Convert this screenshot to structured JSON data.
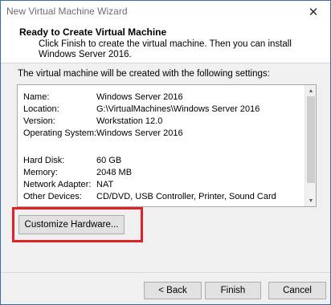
{
  "window": {
    "title": "New Virtual Machine Wizard",
    "close_glyph": "✕"
  },
  "header": {
    "title": "Ready to Create Virtual Machine",
    "subtitle": "Click Finish to create the virtual machine. Then you can install Windows Server 2016."
  },
  "intro": "The virtual machine will be created with the following settings:",
  "settings": [
    {
      "label": "Name:",
      "value": "Windows Server 2016"
    },
    {
      "label": "Location:",
      "value": "G:\\VirtualMachines\\Windows Server 2016"
    },
    {
      "label": "Version:",
      "value": "Workstation 12.0"
    },
    {
      "label": "Operating System:",
      "value": "Windows Server 2016"
    },
    {
      "label": "Hard Disk:",
      "value": "60 GB"
    },
    {
      "label": "Memory:",
      "value": "2048 MB"
    },
    {
      "label": "Network Adapter:",
      "value": "NAT"
    },
    {
      "label": "Other Devices:",
      "value": "CD/DVD, USB Controller, Printer, Sound Card"
    }
  ],
  "scrollbar": {
    "up_glyph": "▲",
    "down_glyph": "▼"
  },
  "buttons": {
    "customize": "Customize Hardware...",
    "back": "< Back",
    "finish": "Finish",
    "cancel": "Cancel"
  },
  "colors": {
    "highlight": "#e0212a",
    "window_border": "#3a6ea5"
  }
}
